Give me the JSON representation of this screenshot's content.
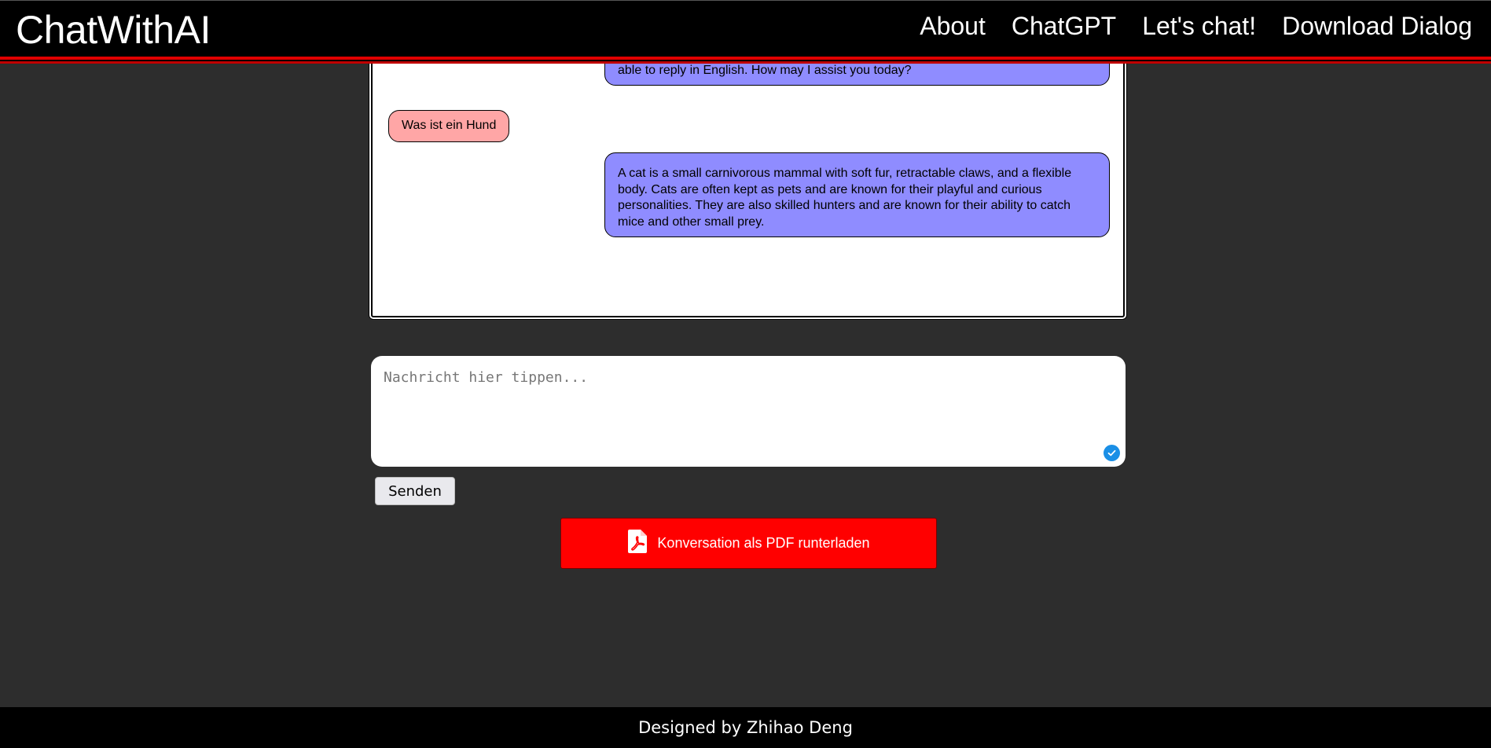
{
  "header": {
    "logo": "ChatWithAI",
    "nav": [
      "About",
      "ChatGPT",
      "Let's chat!",
      "Download Dialog"
    ]
  },
  "chat": {
    "messages": [
      {
        "role": "ai",
        "text": "As an AI language model designed to support communication in English, I am only able to reply in English. How may I assist you today?"
      },
      {
        "role": "user",
        "text": "Was ist ein Hund"
      },
      {
        "role": "ai",
        "text": "A cat is a small carnivorous mammal with soft fur, retractable claws, and a flexible body. Cats are often kept as pets and are known for their playful and curious personalities. They are also skilled hunters and are known for their ability to catch mice and other small prey."
      }
    ]
  },
  "input": {
    "placeholder": "Nachricht hier tippen...",
    "value": ""
  },
  "send_label": "Senden",
  "pdf_label": "Konversation als PDF runterladen",
  "footer": "Designed by Zhihao Deng",
  "colors": {
    "background": "#2d2d2d",
    "header": "#000000",
    "accent_red": "#ff0000",
    "ai_bubble": "#8f8cff",
    "user_bubble": "#ffa6a6"
  }
}
